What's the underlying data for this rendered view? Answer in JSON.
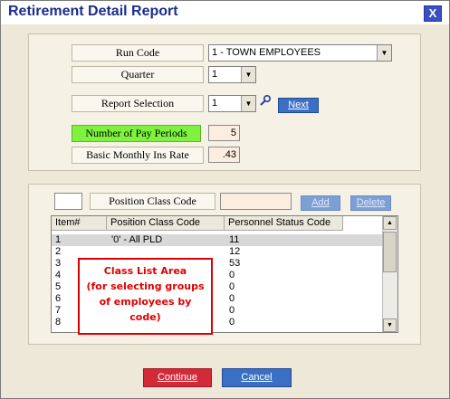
{
  "window": {
    "title": "Retirement Detail Report",
    "close_glyph": "X"
  },
  "form": {
    "run_code": {
      "label": "Run Code",
      "value": "1 - TOWN EMPLOYEES"
    },
    "quarter": {
      "label": "Quarter",
      "value": "1"
    },
    "report_selection": {
      "label": "Report Selection",
      "value": "1",
      "next_label": "Next"
    },
    "pay_periods": {
      "label": "Number of Pay Periods",
      "value": "5"
    },
    "ins_rate": {
      "label": "Basic Monthly Ins Rate",
      "value": ".43"
    }
  },
  "class_filter": {
    "label": "Position Class Code",
    "value": "",
    "add_label": "Add",
    "delete_label": "Delete"
  },
  "class_list": {
    "columns": [
      "Item#",
      "Position Class Code",
      "Personnel Status Code"
    ],
    "rows": [
      {
        "item": "1",
        "class_code": "'0' - All PLD",
        "status": "11"
      },
      {
        "item": "2",
        "class_code": "",
        "status": "12"
      },
      {
        "item": "3",
        "class_code": "",
        "status": "53"
      },
      {
        "item": "4",
        "class_code": "",
        "status": "0"
      },
      {
        "item": "5",
        "class_code": "",
        "status": "0"
      },
      {
        "item": "6",
        "class_code": "",
        "status": "0"
      },
      {
        "item": "7",
        "class_code": "",
        "status": "0"
      },
      {
        "item": "8",
        "class_code": "",
        "status": "0"
      }
    ]
  },
  "annotation": {
    "lines": [
      "Class List Area",
      "(for selecting groups",
      "of employees by",
      "code)"
    ]
  },
  "footer": {
    "continue_label": "Continue",
    "cancel_label": "Cancel"
  },
  "colors": {
    "title": "#1c2d8c",
    "highlight_label": "#7ef23e",
    "button": "#3b6fc4",
    "continue_button": "#d32a3a",
    "annotation": "#e00000"
  }
}
